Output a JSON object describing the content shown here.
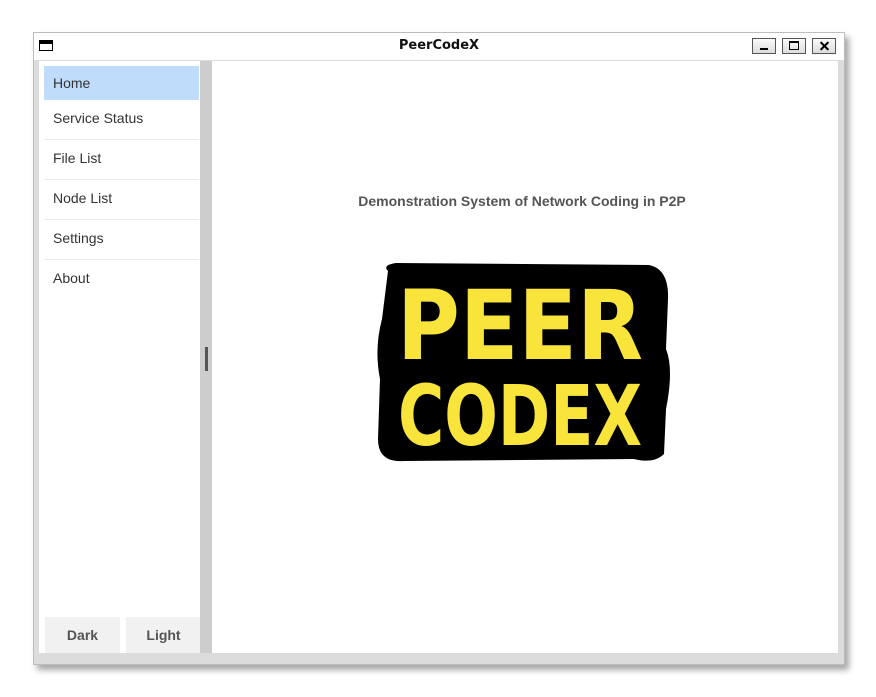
{
  "window": {
    "title": "PeerCodeX"
  },
  "sidebar": {
    "items": [
      {
        "label": "Home",
        "active": true
      },
      {
        "label": "Service Status"
      },
      {
        "label": "File List"
      },
      {
        "label": "Node List"
      },
      {
        "label": "Settings"
      },
      {
        "label": "About"
      }
    ],
    "theme_buttons": {
      "dark": "Dark",
      "light": "Light"
    }
  },
  "main": {
    "subtitle": "Demonstration System of Network Coding in P2P",
    "logo": {
      "line1": "PEER",
      "line2": "CODEX",
      "fill_color": "#f9e43b",
      "outline_color": "#000000"
    }
  },
  "colors": {
    "active_item_bg": "#c0dcfb",
    "splitter": "#cdcdcd",
    "title_text": "#111111"
  }
}
